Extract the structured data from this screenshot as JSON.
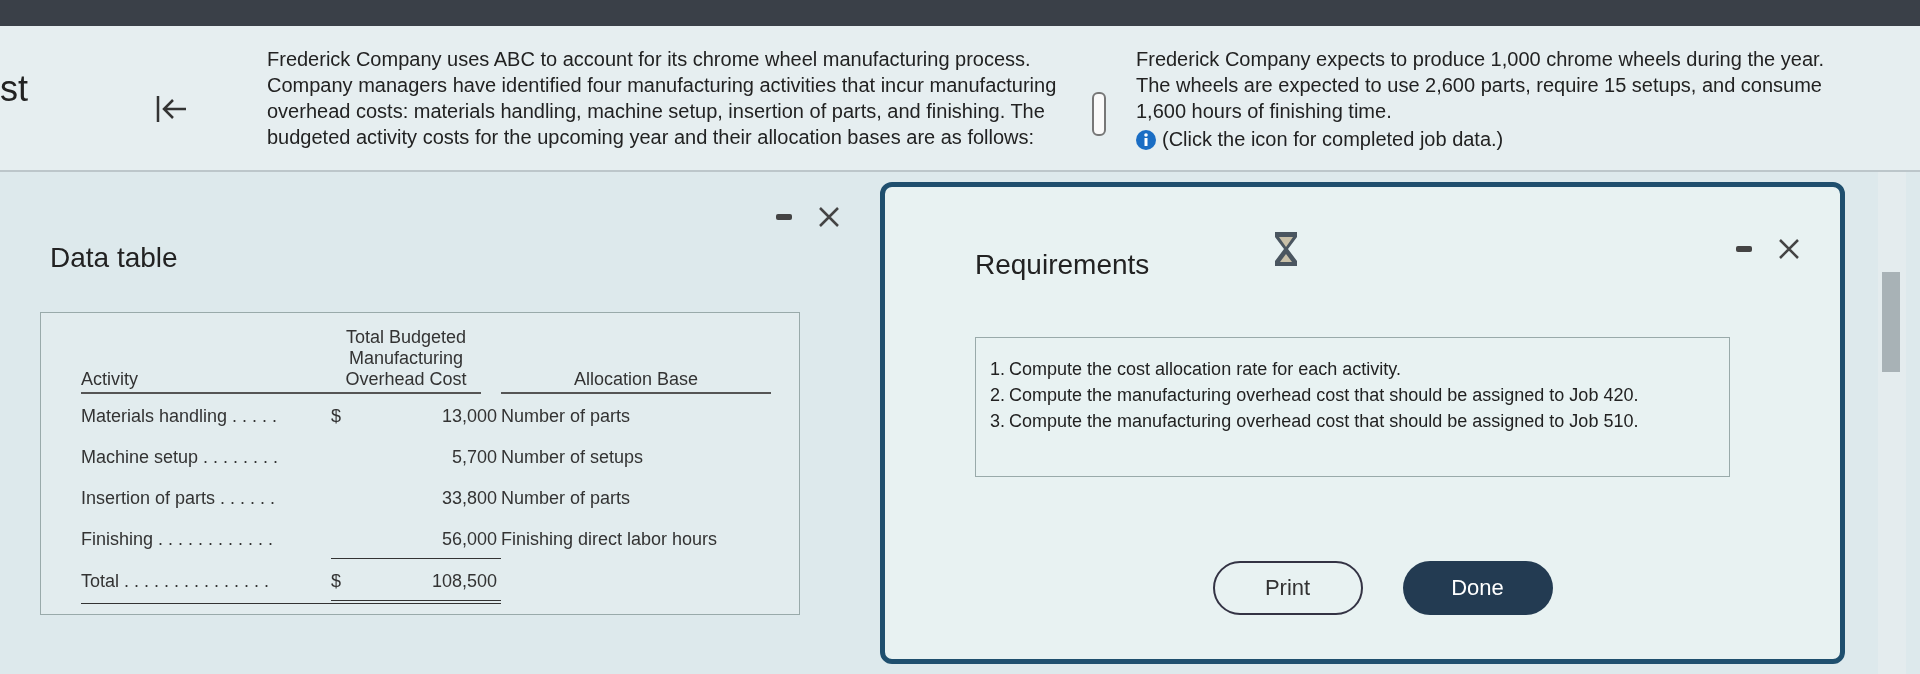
{
  "top_panel": {
    "cut_label": "st",
    "left_text": "Frederick Company uses ABC to account for its chrome wheel manufacturing process. Company managers have identified four manufacturing activities that incur manufacturing overhead costs: materials handling, machine setup, insertion of parts, and finishing. The budgeted activity costs for the upcoming year and their allocation bases are as follows:",
    "right_text": "Frederick Company expects to produce 1,000 chrome wheels during the year. The wheels are expected to use 2,600 parts, require 15 setups, and consume 1,600 hours of finishing time.",
    "info_note": "(Click the icon for completed job data.)"
  },
  "data_table": {
    "title": "Data table",
    "columns": [
      "Activity",
      "Total Budgeted Manufacturing Overhead Cost",
      "Allocation Base"
    ],
    "rows": [
      {
        "activity": "Materials handling",
        "leader": ". . . . .",
        "currency": "$",
        "cost": "13,000",
        "base": "Number of parts"
      },
      {
        "activity": "Machine setup",
        "leader": ". . . . . . . .",
        "cost": "5,700",
        "base": "Number of setups"
      },
      {
        "activity": "Insertion of parts",
        "leader": ". . . . . .",
        "cost": "33,800",
        "base": "Number of parts"
      },
      {
        "activity": "Finishing",
        "leader": ". . . . . . . . . . . .",
        "cost": "56,000",
        "base": "Finishing direct labor hours"
      }
    ],
    "total": {
      "label": "Total",
      "leader": ". . . . . . . . . . . . . . .",
      "currency": "$",
      "cost": "108,500"
    }
  },
  "requirements": {
    "title": "Requirements",
    "items": [
      {
        "number": "1.",
        "text": "Compute the cost allocation rate for each activity."
      },
      {
        "number": "2.",
        "text": "Compute the manufacturing overhead cost that should be assigned to Job 420."
      },
      {
        "number": "3.",
        "text": "Compute the manufacturing overhead cost that should be assigned to Job 510."
      }
    ],
    "buttons": [
      {
        "label": "Print",
        "kind": "outline"
      },
      {
        "label": "Done",
        "kind": "filled"
      }
    ]
  }
}
